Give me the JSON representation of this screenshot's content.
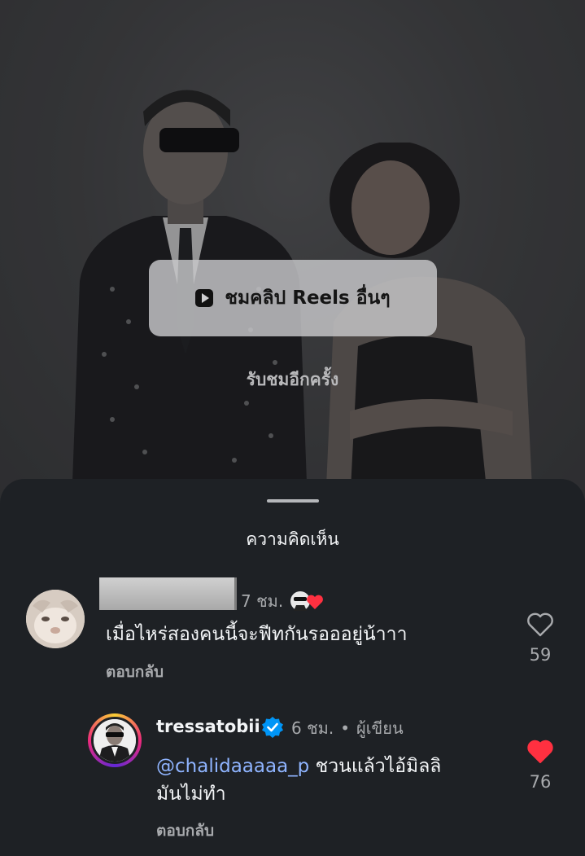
{
  "video": {
    "watch_more_label": "ชมคลิป Reels อื่นๆ",
    "rewatch_label": "รับชมอีกครั้ง"
  },
  "sheet": {
    "title": "ความคิดเห็น"
  },
  "comments": [
    {
      "username": "",
      "time": "7 ชม.",
      "text": "เมื่อไหร่สองคนนี้จะฟีทกันรอออยู่น้าาา",
      "reply_label": "ตอบกลับ",
      "like_count": "59",
      "liked": false,
      "creator_reacted": true,
      "avatar_icon": "profile-photo"
    },
    {
      "username": "tressatobii",
      "verified": true,
      "time": "6 ชม.",
      "separator": "•",
      "author_badge": "ผู้เขียน",
      "mention": "@chalidaaaaa_p",
      "text_line1": " ชวนแล้วไอ้มิลลิ",
      "text_line2": "มันไม่ทำ",
      "reply_label": "ตอบกลับ",
      "like_count": "76",
      "liked": true,
      "avatar_icon": "profile-photo-story-ring"
    }
  ],
  "colors": {
    "sheet_bg": "#1e2125",
    "text_primary": "#f3f5f7",
    "text_secondary": "#a8aaad",
    "mention": "#8fb4ff",
    "like_red": "#ff3040",
    "verified_blue": "#0095f6"
  }
}
